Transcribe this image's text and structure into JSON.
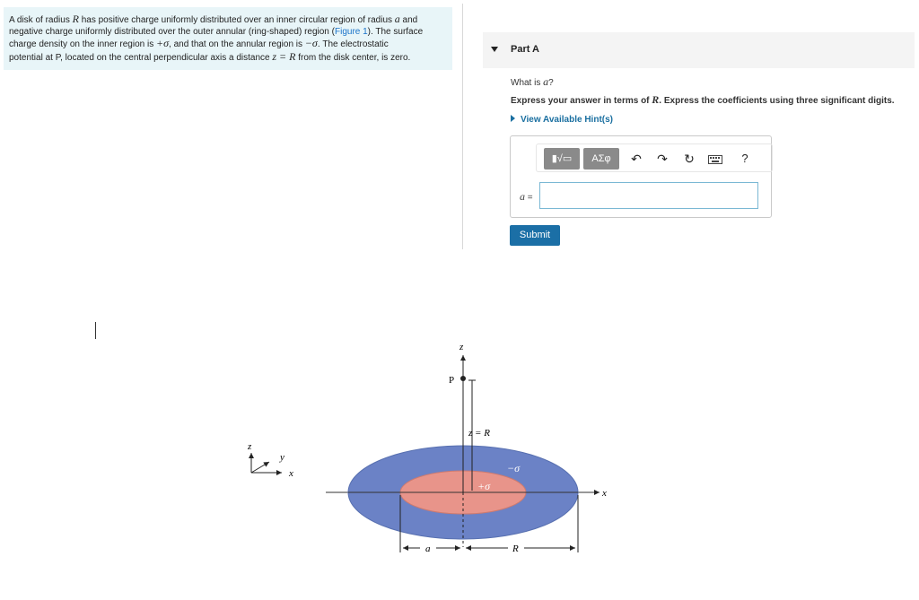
{
  "problem": {
    "line1_a": "A disk of radius ",
    "line1_R": "R",
    "line1_b": " has positive charge uniformly distributed over an inner circular region of radius ",
    "line1_a_var": "a",
    "line1_c": " and",
    "line2": "negative charge uniformly distributed over the outer annular (ring-shaped) region (",
    "line2_link": "Figure 1",
    "line2_end": "). The surface",
    "line3_a": "charge density on the inner region is ",
    "line3_pos": "+σ",
    "line3_b": ", and that on the annular region is ",
    "line3_neg": "−σ",
    "line3_c": ". The electrostatic",
    "line4_a": "potential at ",
    "line4_P": "P",
    "line4_b": ", located on the central perpendicular axis a distance ",
    "line4_z": "z = R",
    "line4_c": " from the disk center, is zero."
  },
  "part": {
    "title": "Part A",
    "question_pre": "What is ",
    "question_var": "a",
    "question_post": "?",
    "instruction_pre": "Express your answer in terms of ",
    "instruction_var": "R",
    "instruction_post": ". Express the coefficients using three significant digits.",
    "hint_label": "View Available Hint(s)"
  },
  "toolbar": {
    "templates_label": "▮√▭",
    "greek_label": "ΑΣφ",
    "undo_icon": "↶",
    "redo_icon": "↷",
    "reset_icon": "↻",
    "keyboard_icon": "keyboard-icon",
    "help_label": "?"
  },
  "answer": {
    "label_var": "a",
    "label_eq": " =",
    "value": ""
  },
  "submit_label": "Submit",
  "figure": {
    "axis_z": "z",
    "axis_x": "x",
    "axis_y": "y",
    "point_P": "P",
    "dist_label": "z = R",
    "inner_charge": "+σ",
    "outer_charge": "−σ",
    "radius_inner": "a",
    "radius_outer": "R",
    "colors": {
      "inner": "#e8948a",
      "outer": "#6b82c6"
    }
  }
}
